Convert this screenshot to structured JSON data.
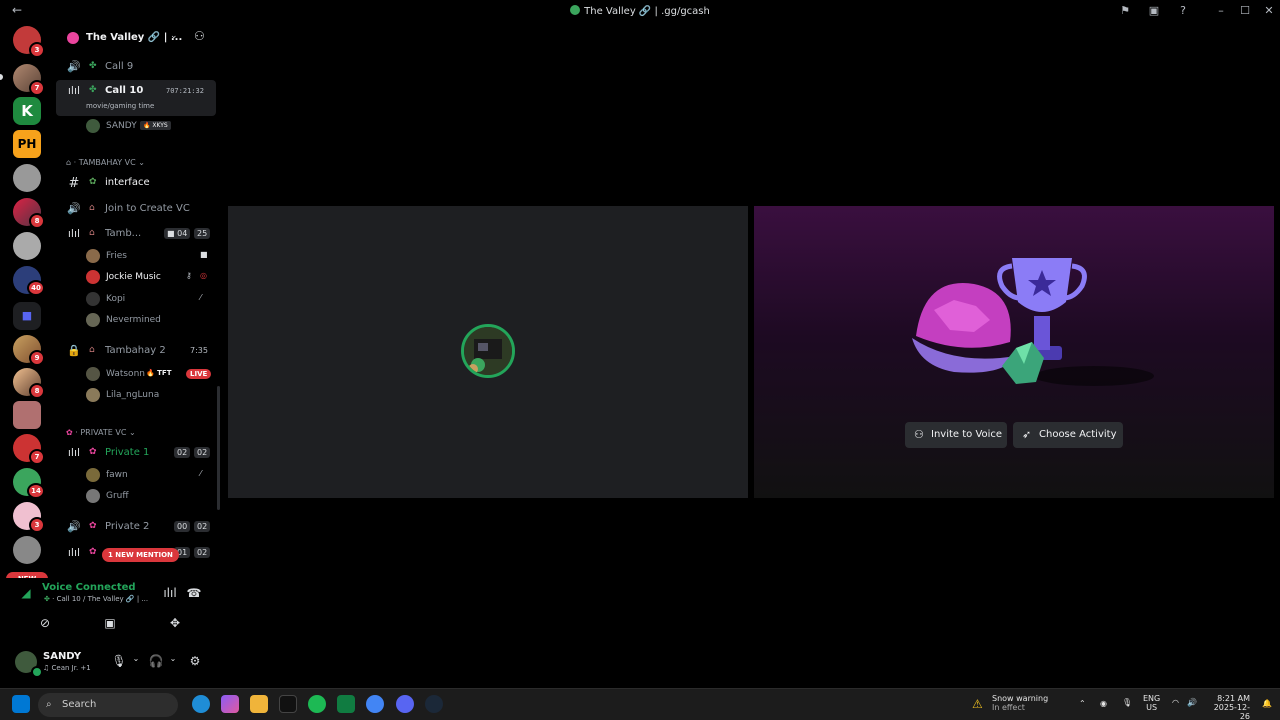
{
  "window": {
    "title": "The Valley 🔗 | .gg/gcash",
    "back_label": "←"
  },
  "rail": {
    "badges": [
      "3",
      "7",
      "9",
      "8",
      "7",
      "14",
      "3",
      "40"
    ],
    "new_label": "NEW"
  },
  "guild": {
    "name": "The Valley 🔗 | ...",
    "channels": {
      "call9": "Call 9",
      "call10": "Call 10",
      "call10_status": "movie/gaming time",
      "call10_timer": "707:21:32",
      "call10_user": "SANDY",
      "call10_user_tag": "XKYS",
      "cat_tambahay": "TAMBAHAY VC",
      "interface": "interface",
      "join_create": "Join to Create VC",
      "tamb": "Tamb...",
      "tamb_count_a": "04",
      "tamb_count_b": "25",
      "tamb_users": [
        "Fries",
        "Jockie Music",
        "Kopi",
        "Nevermined"
      ],
      "tambahay2": "Tambahay 2",
      "tambahay2_timer": "7:35",
      "tambahay2_users": [
        "Watsonn",
        "Lila_ngLuna"
      ],
      "watsonn_tag": "TFT",
      "live_label": "LIVE",
      "cat_private": "PRIVATE VC",
      "private1": "Private 1",
      "private1_a": "02",
      "private1_b": "02",
      "private1_users": [
        "fawn",
        "Gruff"
      ],
      "private2": "Private 2",
      "private2_a": "00",
      "private2_b": "02",
      "private3_a": "01",
      "private3_b": "02",
      "mention_label": "1 NEW MENTION"
    }
  },
  "voice": {
    "status": "Voice Connected",
    "location": "Call 10 / The Valley 🔗 | ..."
  },
  "user": {
    "name": "SANDY",
    "status": "♫ Cean Jr. +1"
  },
  "stage": {
    "invite_label": "Invite to Voice",
    "activity_label": "Choose Activity"
  },
  "taskbar": {
    "search_placeholder": "Search",
    "weather_title": "Snow warning",
    "weather_sub": "In effect",
    "lang_top": "ENG",
    "lang_bottom": "US",
    "time": "8:21 AM",
    "date": "2025-12-26"
  },
  "colors": {
    "accent_green": "#23a55a",
    "danger_red": "#da373c",
    "pink": "#eb459e"
  }
}
